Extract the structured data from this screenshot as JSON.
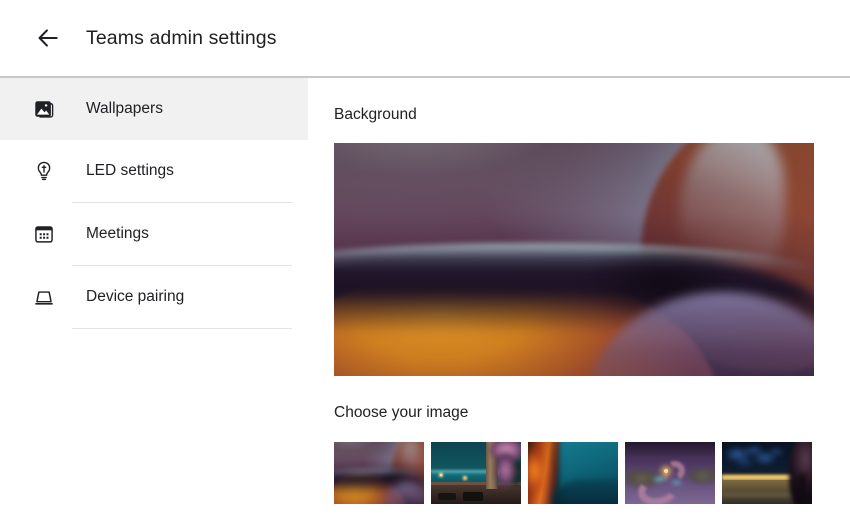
{
  "header": {
    "back_icon": "arrow-left-icon",
    "title": "Teams admin settings"
  },
  "sidebar": {
    "items": [
      {
        "label": "Wallpapers",
        "icon": "image-icon",
        "active": true
      },
      {
        "label": "LED settings",
        "icon": "lightbulb-icon",
        "active": false
      },
      {
        "label": "Meetings",
        "icon": "calendar-icon",
        "active": false
      },
      {
        "label": "Device pairing",
        "icon": "device-icon",
        "active": false
      }
    ]
  },
  "content": {
    "background_title": "Background",
    "choose_title": "Choose your image",
    "hero": {
      "name": "abstract-purple-orange-wave",
      "selected": true
    },
    "thumbnails": [
      {
        "name": "abstract-purple-orange-wave",
        "selected": true
      },
      {
        "name": "teal-sea-terrace-bougainvillea",
        "selected": false
      },
      {
        "name": "orange-teal-gradient-curve",
        "selected": false
      },
      {
        "name": "purple-aerial-river-lights",
        "selected": false
      },
      {
        "name": "night-sky-lit-wall-tree",
        "selected": false
      }
    ]
  },
  "colors": {
    "page_background": "#ffffff",
    "text_primary": "#202124",
    "active_row": "#f1f1f1",
    "divider": "#e3e3e3",
    "header_divider": "#c8c8c8"
  }
}
